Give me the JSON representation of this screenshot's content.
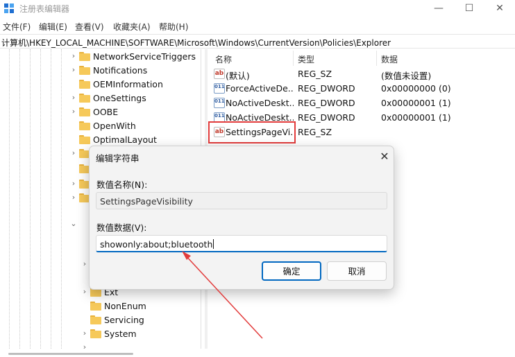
{
  "window": {
    "title": "注册表编辑器",
    "controls": {
      "minimize": "—",
      "maximize": "☐",
      "close": "✕"
    }
  },
  "menu": [
    "文件(F)",
    "编辑(E)",
    "查看(V)",
    "收藏夹(A)",
    "帮助(H)"
  ],
  "address": "计算机\\HKEY_LOCAL_MACHINE\\SOFTWARE\\Microsoft\\Windows\\CurrentVersion\\Policies\\Explorer",
  "tree": [
    {
      "label": "NetworkServiceTriggers",
      "chevron": "›"
    },
    {
      "label": "Notifications",
      "chevron": "›"
    },
    {
      "label": "OEMInformation",
      "chevron": ""
    },
    {
      "label": "OneSettings",
      "chevron": "›"
    },
    {
      "label": "OOBE",
      "chevron": "›"
    },
    {
      "label": "OpenWith",
      "chevron": ""
    },
    {
      "label": "OptimalLayout",
      "chevron": ""
    },
    {
      "label": "Ext",
      "chevron": "›"
    },
    {
      "label": "NonEnum",
      "chevron": ""
    },
    {
      "label": "Servicing",
      "chevron": ""
    },
    {
      "label": "System",
      "chevron": "›"
    }
  ],
  "values_pane": {
    "headers": {
      "name": "名称",
      "type": "类型",
      "data": "数据"
    },
    "rows": [
      {
        "icon": "string-value-icon",
        "icon_text": "ab",
        "name": "(默认)",
        "type": "REG_SZ",
        "data": "(数值未设置)"
      },
      {
        "icon": "binary-value-icon",
        "icon_text": "011",
        "name": "ForceActiveDe...",
        "type": "REG_DWORD",
        "data": "0x00000000 (0)"
      },
      {
        "icon": "binary-value-icon",
        "icon_text": "011",
        "name": "NoActiveDeskt...",
        "type": "REG_DWORD",
        "data": "0x00000001 (1)"
      },
      {
        "icon": "binary-value-icon",
        "icon_text": "011",
        "name": "NoActiveDeskt...",
        "type": "REG_DWORD",
        "data": "0x00000001 (1)"
      },
      {
        "icon": "string-value-icon",
        "icon_text": "ab",
        "name": "SettingsPageVi...",
        "type": "REG_SZ",
        "data": ""
      }
    ]
  },
  "dialog": {
    "title": "编辑字符串",
    "close": "✕",
    "name_label": "数值名称(N):",
    "name_value": "SettingsPageVisibility",
    "data_label": "数值数据(V):",
    "data_value": "showonly:about;bluetooth",
    "ok_label": "确定",
    "cancel_label": "取消"
  },
  "colors": {
    "accent": "#0067c0",
    "annotation": "#e23b3b",
    "folder": "#f6c95a"
  }
}
